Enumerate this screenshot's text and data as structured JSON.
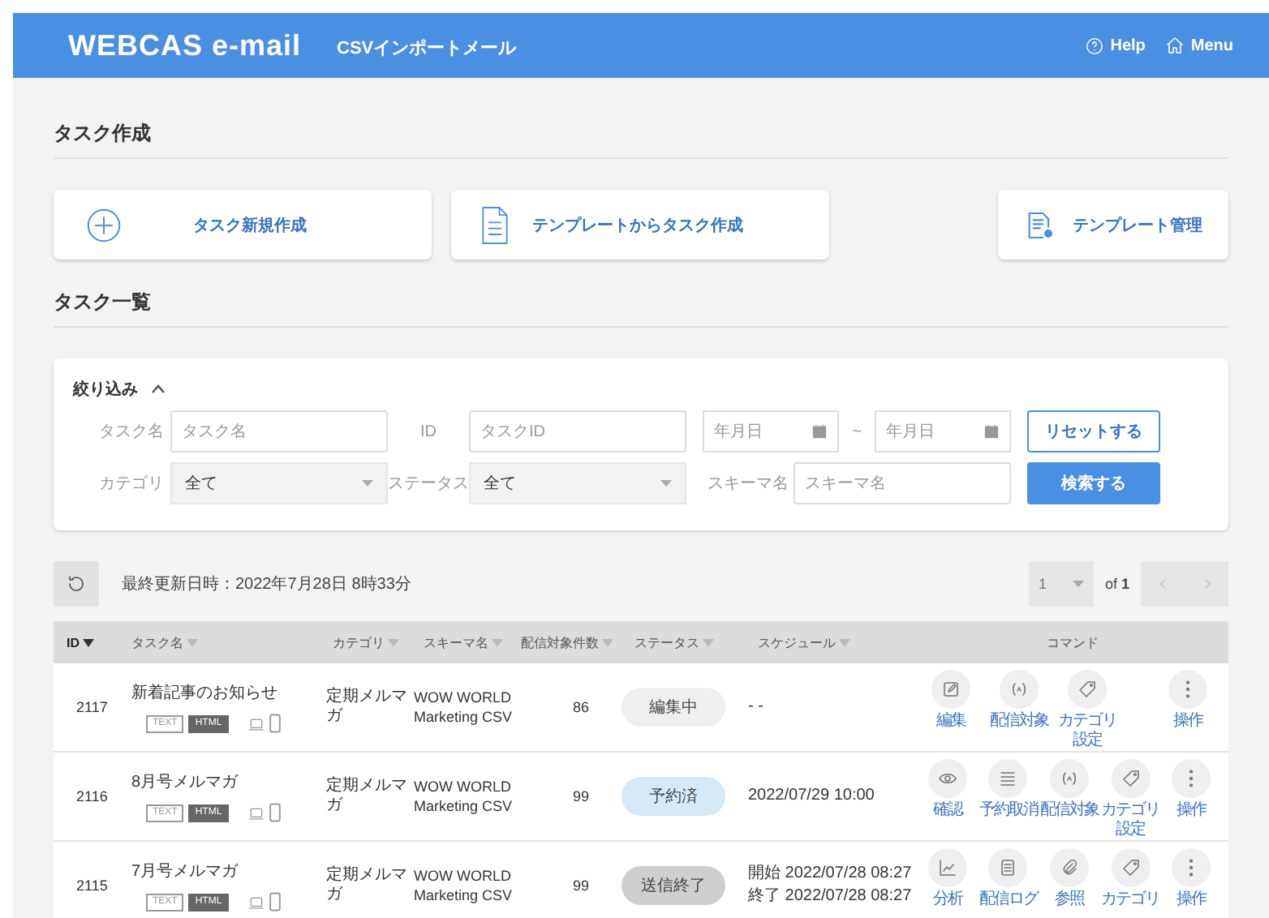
{
  "header": {
    "logo": "WEBCAS e-mail",
    "subtitle": "CSVインポートメール",
    "links": [
      {
        "kind": "help",
        "label": "Help"
      },
      {
        "kind": "menu",
        "label": "Menu"
      }
    ]
  },
  "create_section": {
    "title": "タスク作成",
    "actions": [
      {
        "kind": "new",
        "label": "タスク新規作成"
      },
      {
        "kind": "template",
        "label": "テンプレートからタスク作成"
      },
      {
        "kind": "manage",
        "label": "テンプレート管理"
      }
    ]
  },
  "list_section": {
    "title": "タスク一覧"
  },
  "filter": {
    "title": "絞り込み",
    "expanded": true,
    "task_name": {
      "label": "タスク名",
      "placeholder": "タスク名"
    },
    "id": {
      "label": "ID",
      "placeholder": "タスクID"
    },
    "date_from": {
      "placeholder": "年月日"
    },
    "date_separator": "~",
    "date_to": {
      "placeholder": "年月日"
    },
    "reset_button": "リセットする",
    "category": {
      "label": "カテゴリ",
      "value": "全て"
    },
    "status": {
      "label": "ステータス",
      "value": "全て"
    },
    "schema": {
      "label": "スキーマ名",
      "placeholder": "スキーマ名"
    },
    "search_button": "検索する"
  },
  "toolbar": {
    "last_updated": "最終更新日時：2022年7月28日 8時33分",
    "page": "1",
    "page_total": "of **1**"
  },
  "table": {
    "columns": [
      {
        "label": "ID",
        "sortable": true,
        "sorted": true
      },
      {
        "label": "タスク名",
        "sortable": true,
        "sorted": false
      },
      {
        "label": "カテゴリ",
        "sortable": true,
        "sorted": false
      },
      {
        "label": "スキーマ名",
        "sortable": true,
        "sorted": false
      },
      {
        "label": "配信対象件数",
        "sortable": true,
        "sorted": false
      },
      {
        "label": "ステータス",
        "sortable": true,
        "sorted": false
      },
      {
        "label": "スケジュール",
        "sortable": true,
        "sorted": false
      },
      {
        "label": "コマンド",
        "sortable": false,
        "sorted": false
      }
    ],
    "rows": [
      {
        "id": "2117",
        "name": "新着記事のお知らせ",
        "formats": [
          {
            "label": "TEXT",
            "kind": "text"
          },
          {
            "label": "HTML",
            "kind": "html"
          }
        ],
        "category": "定期メルマガ",
        "schema": "WOW WORLD Marketing CSV",
        "count": "86",
        "status": {
          "label": "編集中",
          "kind": "editing"
        },
        "schedule": [
          "- -"
        ],
        "commands": [
          {
            "kind": "edit",
            "label": "編集"
          },
          {
            "kind": "target",
            "label": "配信対象"
          },
          {
            "kind": "tag",
            "label": "カテゴリ設定"
          }
        ],
        "menu_label": "操作"
      },
      {
        "id": "2116",
        "name": "8月号メルマガ",
        "formats": [
          {
            "label": "TEXT",
            "kind": "text"
          },
          {
            "label": "HTML",
            "kind": "html"
          }
        ],
        "category": "定期メルマガ",
        "schema": "WOW WORLD Marketing CSV",
        "count": "99",
        "status": {
          "label": "予約済",
          "kind": "scheduled"
        },
        "schedule": [
          "2022/07/29 10:00"
        ],
        "commands": [
          {
            "kind": "view",
            "label": "確認"
          },
          {
            "kind": "list",
            "label": "予約取消"
          },
          {
            "kind": "target",
            "label": "配信対象"
          },
          {
            "kind": "tag",
            "label": "カテゴリ設定"
          }
        ],
        "menu_label": "操作"
      },
      {
        "id": "2115",
        "name": "7月号メルマガ",
        "formats": [
          {
            "label": "TEXT",
            "kind": "text"
          },
          {
            "label": "HTML",
            "kind": "html"
          }
        ],
        "category": "定期メルマガ",
        "schema": "WOW WORLD Marketing CSV",
        "count": "99",
        "status": {
          "label": "送信終了",
          "kind": "sent"
        },
        "schedule": [
          "開始 2022/07/28 08:27",
          "終了 2022/07/28 08:27"
        ],
        "commands": [
          {
            "kind": "chart",
            "label": "分析"
          },
          {
            "kind": "log",
            "label": "配信ログ"
          },
          {
            "kind": "clip",
            "label": "参照"
          },
          {
            "kind": "tag",
            "label": "カテゴリ"
          }
        ],
        "menu_label": "操作"
      }
    ]
  }
}
